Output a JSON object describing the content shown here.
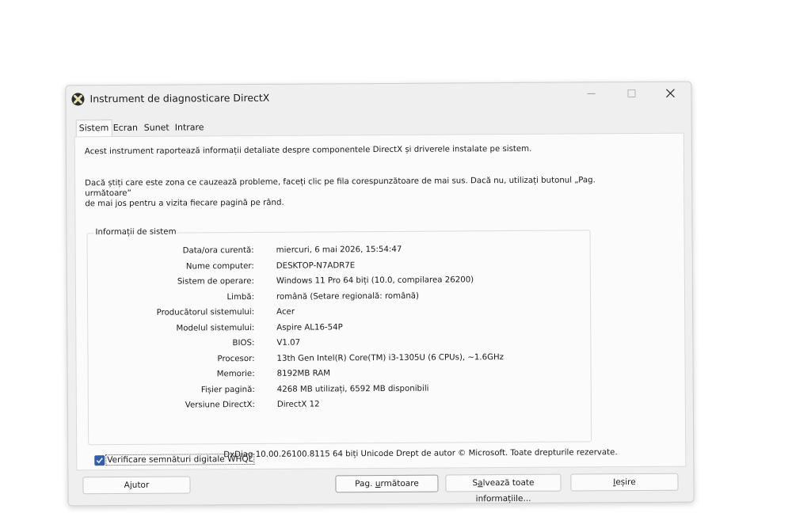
{
  "window": {
    "title": "Instrument de diagnosticare DirectX"
  },
  "tabs": [
    {
      "label": "Sistem",
      "active": true
    },
    {
      "label": "Ecran",
      "active": false
    },
    {
      "label": "Sunet",
      "active": false
    },
    {
      "label": "Intrare",
      "active": false
    }
  ],
  "intro": "Acest instrument raportează informații detaliate despre componentele DirectX și driverele instalate pe sistem.",
  "hint": {
    "line1": "Dacă știți care este zona ce cauzează probleme, faceți clic pe fila corespunzătoare de mai sus. Dacă nu, utilizați butonul „Pag. următoare”",
    "line2": "de mai jos pentru a vizita fiecare pagină pe rând."
  },
  "system_info": {
    "title": "Informații de sistem",
    "rows": [
      {
        "label": "Data/ora curentă:",
        "value": "miercuri, 6 mai 2026, 15:54:47"
      },
      {
        "label": "Nume computer:",
        "value": "DESKTOP-N7ADR7E"
      },
      {
        "label": "Sistem de operare:",
        "value": "Windows 11 Pro 64 biți (10.0, compilarea 26200)"
      },
      {
        "label": "Limbă:",
        "value": "română (Setare regională: română)"
      },
      {
        "label": "Producătorul sistemului:",
        "value": "Acer"
      },
      {
        "label": "Modelul sistemului:",
        "value": "Aspire AL16-54P"
      },
      {
        "label": "BIOS:",
        "value": "V1.07"
      },
      {
        "label": "Procesor:",
        "value": "13th Gen Intel(R) Core(TM) i3-1305U (6 CPUs), ~1.6GHz"
      },
      {
        "label": "Memorie:",
        "value": "8192MB RAM"
      },
      {
        "label": "Fișier pagină:",
        "value": "4268 MB utilizați, 6592 MB disponibili"
      },
      {
        "label": "Versiune DirectX:",
        "value": "DirectX 12"
      }
    ]
  },
  "whql": {
    "label": "Verificare semnături digitale WHQL",
    "checked": true
  },
  "footer_note": "DxDiag 10.00.26100.8115 64 biți Unicode  Drept de autor © Microsoft. Toate drepturile rezervate.",
  "buttons": {
    "help": {
      "pre": "A",
      "acc": "j",
      "post": "utor"
    },
    "next": {
      "pre": "Pag. ",
      "acc": "u",
      "post": "rmătoare"
    },
    "save": {
      "pre": "S",
      "acc": "a",
      "post": "lvează toate informațiile..."
    },
    "exit": {
      "pre": "",
      "acc": "I",
      "post": "eșire"
    }
  },
  "colors": {
    "window_bg": "#f0efef",
    "panel_bg": "#fbfbfb",
    "checkbox_accent": "#2f5fb3"
  },
  "icons": {
    "app": "directx-icon",
    "minimize": "minimize-icon",
    "maximize": "maximize-icon",
    "close": "close-icon",
    "check": "checkmark-icon"
  }
}
